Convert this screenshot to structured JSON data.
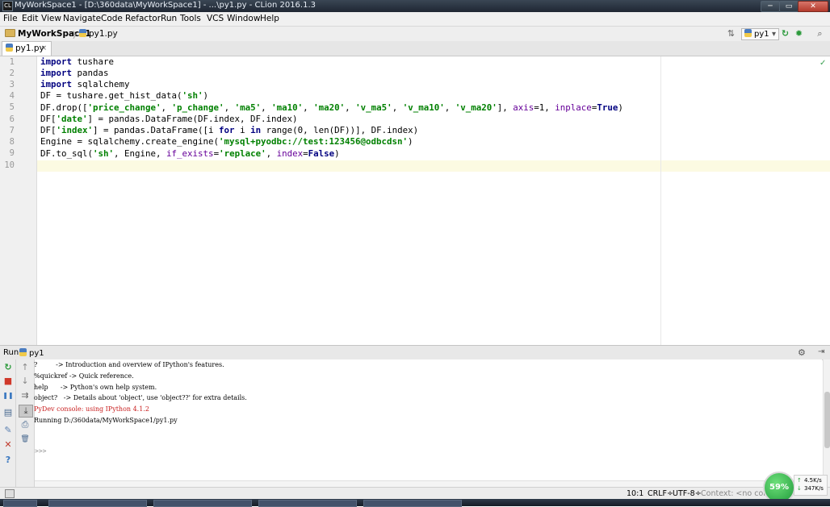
{
  "window": {
    "title": "MyWorkSpace1 - [D:\\360data\\MyWorkSpace1] - ...\\py1.py - CLion 2016.1.3",
    "app_icon": "clion-app-icon",
    "minimize_glyph": "─",
    "maximize_glyph": "▭",
    "close_glyph": "✕"
  },
  "menu": [
    "File",
    "Edit",
    "View",
    "Navigate",
    "Code",
    "Refactor",
    "Run",
    "Tools",
    "VCS",
    "Window",
    "Help"
  ],
  "breadcrumb": {
    "project": "MyWorkSpace1",
    "file": "py1.py",
    "sep1": "〉",
    "sep2": "〉"
  },
  "toolbar": {
    "sort_glyph": "⇅",
    "run_config": "py1",
    "dropdown_glyph": "▾",
    "run_glyph": "↻",
    "debug_glyph": "✹",
    "search_glyph": "⌕"
  },
  "tabs": [
    {
      "label": "py1.py",
      "close": "×"
    }
  ],
  "editor": {
    "line_numbers": [
      "1",
      "2",
      "3",
      "4",
      "5",
      "6",
      "7",
      "8",
      "9",
      "10"
    ],
    "check_glyph": "✓",
    "lines": {
      "l1": {
        "kw": "import",
        "rest": " tushare"
      },
      "l2": {
        "kw": "import",
        "rest": " pandas"
      },
      "l3": {
        "kw": "import",
        "rest": " sqlalchemy"
      },
      "l4": {
        "a": "DF = tushare.get_hist_data(",
        "s1": "'sh'",
        "b": ")"
      },
      "l5": {
        "a": "DF.drop([",
        "s1": "'price_change'",
        "c1": ", ",
        "s2": "'p_change'",
        "c2": ", ",
        "s3": "'ma5'",
        "c3": ", ",
        "s4": "'ma10'",
        "c4": ", ",
        "s5": "'ma20'",
        "c5": ", ",
        "s6": "'v_ma5'",
        "c6": ", ",
        "s7": "'v_ma10'",
        "c7": ", ",
        "s8": "'v_ma20'",
        "b": "], ",
        "k1": "axis",
        "e1": "=1, ",
        "k2": "inplace",
        "e2": "=",
        "v": "True",
        "end": ")"
      },
      "l6": {
        "a": "DF[",
        "s1": "'date'",
        "b": "] = pandas.DataFrame(DF.index, DF.index)"
      },
      "l7": {
        "a": "DF[",
        "s1": "'index'",
        "b": "] = pandas.DataFrame([i ",
        "k1": "for",
        "c": " i ",
        "k2": "in",
        "d": " range(0, len(DF))], DF.index)"
      },
      "l8": {
        "a": "Engine = sqlalchemy.create_engine(",
        "s1": "'mysql+pyodbc://test:123456@odbcdsn'",
        "b": ")"
      },
      "l9": {
        "a": "DF.to_sql(",
        "s1": "'sh'",
        "b": ", Engine, ",
        "k1": "if_exists",
        "c": "=",
        "s2": "'replace'",
        "d": ", ",
        "k2": "index",
        "e": "=",
        "v": "False",
        "end": ")"
      }
    }
  },
  "run_panel": {
    "label": "Run",
    "config": "py1",
    "gear_glyph": "⚙",
    "collapse_glyph": "⇥",
    "side_buttons": {
      "rerun": "↻",
      "stop": "■",
      "pause": "❚❚",
      "console": "▤",
      "pin": "✎",
      "close": "✕",
      "help": "?",
      "up": "↑",
      "down": "↓",
      "wrap": "⇉",
      "scroll": "⤓",
      "print": "⎙",
      "trash": "🗑"
    },
    "console_lines": [
      {
        "text": "?         -> Introduction and overview of IPython's features.",
        "red": false
      },
      {
        "text": "%quickref -> Quick reference.",
        "red": false
      },
      {
        "text": "help      -> Python's own help system.",
        "red": false
      },
      {
        "text": "object?   -> Details about 'object', use 'object??' for extra details.",
        "red": false
      },
      {
        "text": "PyDev console: using IPython 4.1.2",
        "red": true
      },
      {
        "text": "Running D:/360data/MyWorkSpace1/py1.py",
        "red": false
      }
    ],
    "prompt": ">>>"
  },
  "status": {
    "position": "10:1",
    "line_sep": "CRLF÷",
    "encoding": "UTF-8÷",
    "context": "Context: <no conte",
    "perf_percent": "59%",
    "net_up": "4.5K/s",
    "net_down": "347K/s",
    "up_arrow": "↑",
    "down_arrow": "↓"
  },
  "colors": {
    "keyword": "#000080",
    "string": "#008000",
    "kwarg": "#660099",
    "current_line": "#fcfae2",
    "console_red": "#c81e1e"
  }
}
